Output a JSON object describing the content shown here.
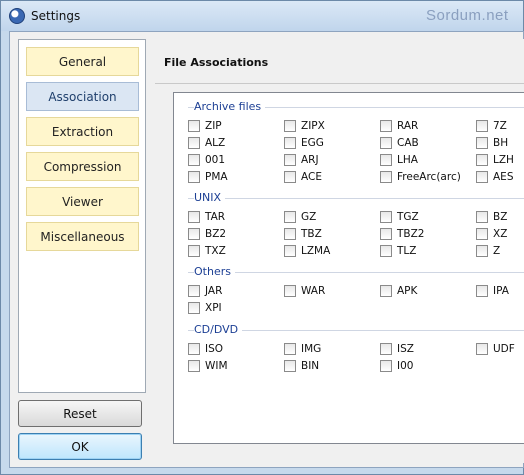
{
  "window": {
    "title": "Settings",
    "watermark": "Sordum.net"
  },
  "nav": {
    "items": [
      {
        "label": "General",
        "active": false
      },
      {
        "label": "Association",
        "active": true
      },
      {
        "label": "Extraction",
        "active": false
      },
      {
        "label": "Compression",
        "active": false
      },
      {
        "label": "Viewer",
        "active": false
      },
      {
        "label": "Miscellaneous",
        "active": false
      }
    ],
    "reset_label": "Reset",
    "ok_label": "OK"
  },
  "panel": {
    "title": "File Associations"
  },
  "groups": [
    {
      "label": "Archive files",
      "items": [
        "ZIP",
        "ZIPX",
        "RAR",
        "7Z",
        "ALZ",
        "EGG",
        "CAB",
        "BH",
        "001",
        "ARJ",
        "LHA",
        "LZH",
        "PMA",
        "ACE",
        "FreeArc(arc)",
        "AES"
      ]
    },
    {
      "label": "UNIX",
      "items": [
        "TAR",
        "GZ",
        "TGZ",
        "BZ",
        "BZ2",
        "TBZ",
        "TBZ2",
        "XZ",
        "TXZ",
        "LZMA",
        "TLZ",
        "Z"
      ]
    },
    {
      "label": "Others",
      "items": [
        "JAR",
        "WAR",
        "APK",
        "IPA",
        "XPI"
      ]
    },
    {
      "label": "CD/DVD",
      "items": [
        "ISO",
        "IMG",
        "ISZ",
        "UDF",
        "WIM",
        "BIN",
        "I00"
      ]
    }
  ],
  "colors": {
    "accent": "#1c3f94",
    "nav_button": "#fff6cc",
    "nav_active": "#dbe6f3"
  }
}
